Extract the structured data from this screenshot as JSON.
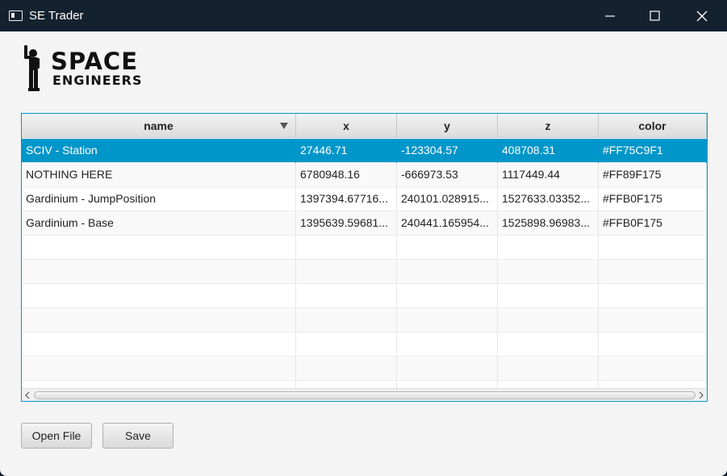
{
  "window": {
    "title": "SE Trader"
  },
  "logo": {
    "line1": "SPACE",
    "line2": "ENGINEERS"
  },
  "table": {
    "columns": [
      "name",
      "x",
      "y",
      "z",
      "color"
    ],
    "sort_column": "name",
    "rows": [
      [
        "SCIV - Station",
        "27446.71",
        "-123304.57",
        "408708.31",
        "#FF75C9F1"
      ],
      [
        "NOTHING HERE",
        "6780948.16",
        "-666973.53",
        "1117449.44",
        "#FF89F175"
      ],
      [
        "Gardinium - JumpPosition",
        "1397394.67716...",
        "240101.028915...",
        "1527633.03352...",
        "#FFB0F175"
      ],
      [
        "Gardinium - Base",
        "1395639.59681...",
        "240441.165954...",
        "1525898.96983...",
        "#FFB0F175"
      ]
    ],
    "selected_row": 0
  },
  "buttons": {
    "open_file": "Open File",
    "save": "Save"
  },
  "colors": {
    "accent": "#0096c9",
    "titlebar": "#14212e"
  }
}
